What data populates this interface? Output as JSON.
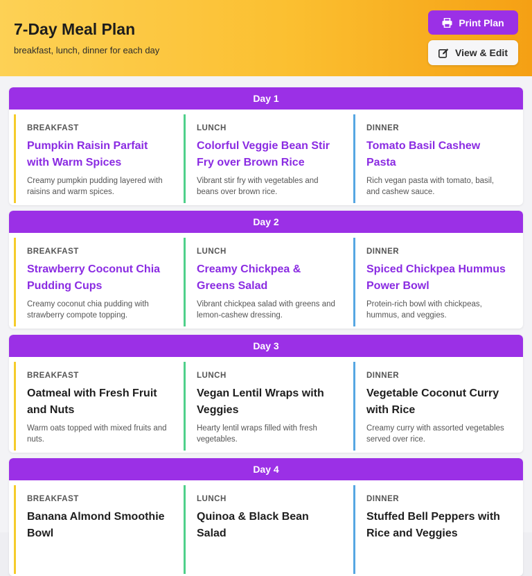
{
  "header": {
    "title": "7-Day Meal Plan",
    "subtitle": "breakfast, lunch, dinner for each day",
    "print_label": "Print Plan",
    "edit_label": "View & Edit"
  },
  "colors": {
    "accent": "#9b30e6",
    "header_gradient_start": "#fdd155",
    "header_gradient_end": "#f5a014",
    "breakfast_border": "#f5cc2a",
    "lunch_border": "#4fd08a",
    "dinner_border": "#56a7e2"
  },
  "days": [
    {
      "label": "Day 1",
      "breakfast": {
        "type": "BREAKFAST",
        "name": "Pumpkin Raisin Parfait with Warm Spices",
        "desc": "Creamy pumpkin pudding layered with raisins and warm spices."
      },
      "lunch": {
        "type": "LUNCH",
        "name": "Colorful Veggie Bean Stir Fry over Brown Rice",
        "desc": "Vibrant stir fry with vegetables and beans over brown rice."
      },
      "dinner": {
        "type": "DINNER",
        "name": "Tomato Basil Cashew Pasta",
        "desc": "Rich vegan pasta with tomato, basil, and cashew sauce."
      }
    },
    {
      "label": "Day 2",
      "breakfast": {
        "type": "BREAKFAST",
        "name": "Strawberry Coconut Chia Pudding Cups",
        "desc": "Creamy coconut chia pudding with strawberry compote topping."
      },
      "lunch": {
        "type": "LUNCH",
        "name": "Creamy Chickpea & Greens Salad",
        "desc": "Vibrant chickpea salad with greens and lemon-cashew dressing."
      },
      "dinner": {
        "type": "DINNER",
        "name": "Spiced Chickpea Hummus Power Bowl",
        "desc": "Protein-rich bowl with chickpeas, hummus, and veggies."
      }
    },
    {
      "label": "Day 3",
      "breakfast": {
        "type": "BREAKFAST",
        "name": "Oatmeal with Fresh Fruit and Nuts",
        "desc": "Warm oats topped with mixed fruits and nuts."
      },
      "lunch": {
        "type": "LUNCH",
        "name": "Vegan Lentil Wraps with Veggies",
        "desc": "Hearty lentil wraps filled with fresh vegetables."
      },
      "dinner": {
        "type": "DINNER",
        "name": "Vegetable Coconut Curry with Rice",
        "desc": "Creamy curry with assorted vegetables served over rice."
      }
    },
    {
      "label": "Day 4",
      "breakfast": {
        "type": "BREAKFAST",
        "name": "Banana Almond Smoothie Bowl",
        "desc": ""
      },
      "lunch": {
        "type": "LUNCH",
        "name": "Quinoa & Black Bean Salad",
        "desc": ""
      },
      "dinner": {
        "type": "DINNER",
        "name": "Stuffed Bell Peppers with Rice and Veggies",
        "desc": ""
      }
    }
  ]
}
